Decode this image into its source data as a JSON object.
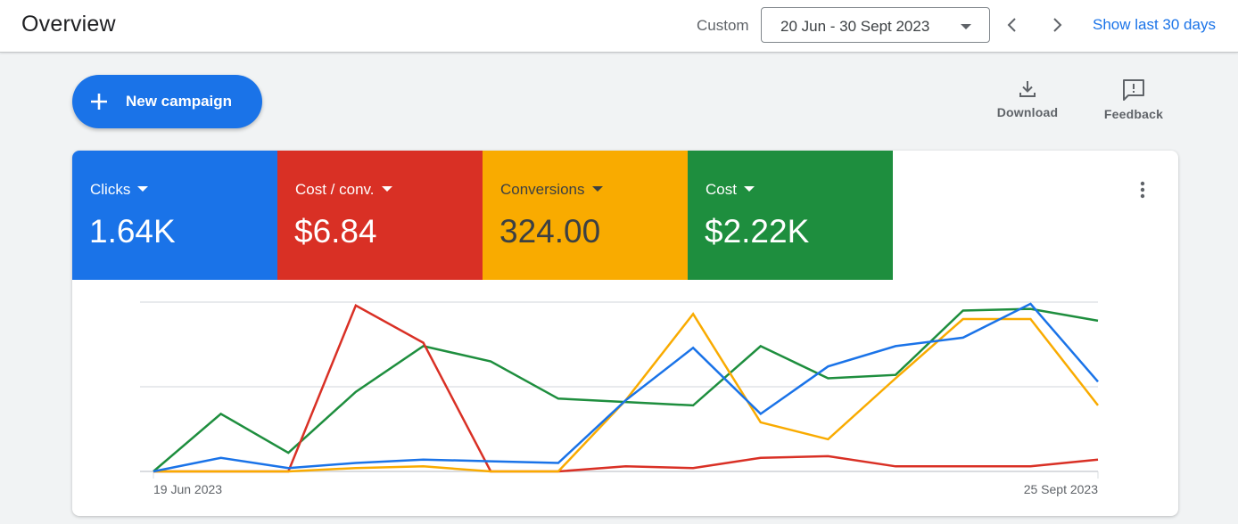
{
  "header": {
    "title": "Overview",
    "range_label": "Custom",
    "date_range": "20 Jun - 30 Sept 2023",
    "show_last_30": "Show last 30 days",
    "prev_icon": "chevron-left-icon",
    "next_icon": "chevron-right-icon"
  },
  "actions": {
    "new_campaign": "New campaign",
    "download": "Download",
    "feedback": "Feedback"
  },
  "metrics": [
    {
      "name": "Clicks",
      "value": "1.64K",
      "color": "#1a73e8"
    },
    {
      "name": "Cost / conv.",
      "value": "$6.84",
      "color": "#d93025"
    },
    {
      "name": "Conversions",
      "value": "324.00",
      "color": "#f9ab00"
    },
    {
      "name": "Cost",
      "value": "$2.22K",
      "color": "#1e8e3e"
    }
  ],
  "chart_data": {
    "type": "line",
    "title": "",
    "xlabel": "",
    "ylabel": "",
    "x_tick_labels": [
      "19 Jun 2023",
      "25 Sept 2023"
    ],
    "point_count": 15,
    "ylim": [
      0,
      100
    ],
    "grid": true,
    "y_gridlines": [
      0,
      50,
      100
    ],
    "normalized": true,
    "series": [
      {
        "name": "Cost",
        "color": "#1e8e3e",
        "values": [
          0,
          34,
          11,
          47,
          74,
          65,
          43,
          41,
          39,
          74,
          55,
          57,
          95,
          96,
          89
        ]
      },
      {
        "name": "Cost / conv.",
        "color": "#d93025",
        "values": [
          0,
          0,
          0,
          98,
          76,
          0,
          0,
          3,
          2,
          8,
          9,
          3,
          3,
          3,
          7
        ]
      },
      {
        "name": "Conversions",
        "color": "#f9ab00",
        "values": [
          0,
          0,
          0,
          2,
          3,
          0,
          0,
          42,
          93,
          29,
          19,
          55,
          90,
          90,
          39
        ]
      },
      {
        "name": "Clicks",
        "color": "#1a73e8",
        "values": [
          0,
          8,
          2,
          5,
          7,
          6,
          5,
          42,
          73,
          34,
          62,
          74,
          79,
          99,
          53
        ]
      }
    ]
  }
}
